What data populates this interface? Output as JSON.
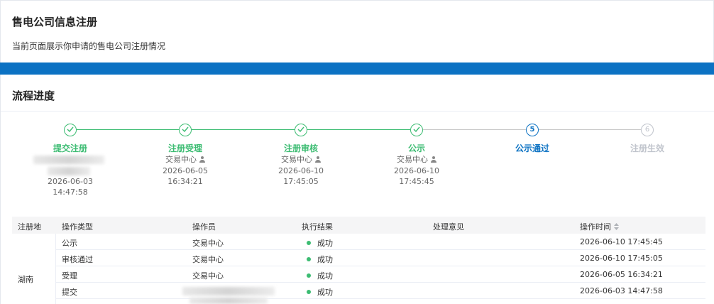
{
  "header": {
    "title": "售电公司信息注册",
    "desc": "当前页面展示你申请的售电公司注册情况"
  },
  "progress": {
    "title": "流程进度",
    "steps": [
      {
        "num": "1",
        "label": "提交注册",
        "status": "done",
        "operator": "",
        "date": "2026-06-03",
        "time": "14:47:58"
      },
      {
        "num": "2",
        "label": "注册受理",
        "status": "done",
        "operator": "交易中心",
        "date": "2026-06-05",
        "time": "16:34:21"
      },
      {
        "num": "3",
        "label": "注册审核",
        "status": "done",
        "operator": "交易中心",
        "date": "2026-06-10",
        "time": "17:45:05"
      },
      {
        "num": "4",
        "label": "公示",
        "status": "done",
        "operator": "交易中心",
        "date": "2026-06-10",
        "time": "17:45:45"
      },
      {
        "num": "5",
        "label": "公示通过",
        "status": "active"
      },
      {
        "num": "6",
        "label": "注册生效",
        "status": "pending"
      }
    ]
  },
  "table": {
    "columns": {
      "region": "注册地",
      "op_type": "操作类型",
      "operator": "操作员",
      "result": "执行结果",
      "opinion": "处理意见",
      "time": "操作时间"
    },
    "region": "湖南",
    "rows": [
      {
        "op_type": "公示",
        "operator": "交易中心",
        "result": "成功",
        "opinion": "",
        "time": "2026-06-10 17:45:45"
      },
      {
        "op_type": "审核通过",
        "operator": "交易中心",
        "result": "成功",
        "opinion": "",
        "time": "2026-06-10 17:45:05"
      },
      {
        "op_type": "受理",
        "operator": "交易中心",
        "result": "成功",
        "opinion": "",
        "time": "2026-06-05 16:34:21"
      },
      {
        "op_type": "提交",
        "operator": "",
        "result": "成功",
        "opinion": "",
        "time": "2026-06-03 14:47:58"
      }
    ]
  },
  "colors": {
    "primary": "#0c72c3",
    "success": "#3cbc72",
    "pending": "#c0c4cc"
  }
}
